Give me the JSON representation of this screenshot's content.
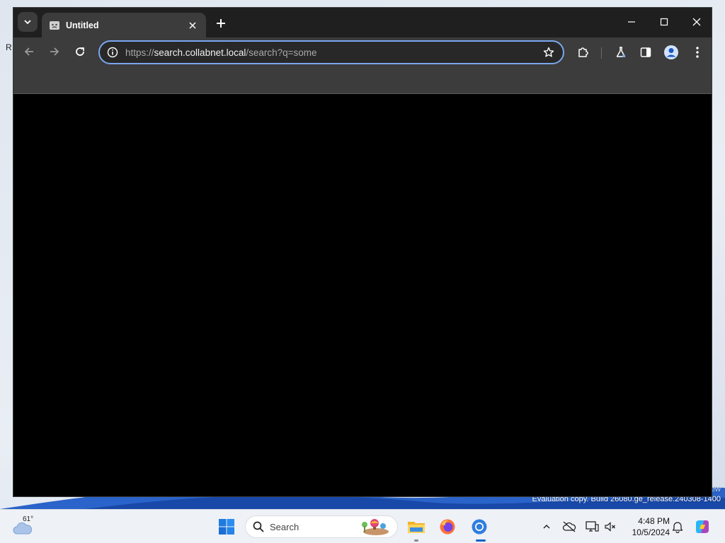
{
  "desktop": {
    "fragment_text": "R",
    "watermark_line1": "ew",
    "watermark_line2": "Evaluation copy. Build 26080.ge_release.240308-1400"
  },
  "browser": {
    "tab": {
      "title": "Untitled"
    },
    "address_bar": {
      "scheme": "https://",
      "host": "search.collabnet.local",
      "path": "/search?q=some"
    }
  },
  "taskbar": {
    "weather": {
      "temp": "61°"
    },
    "search": {
      "label": "Search"
    },
    "clock": {
      "time": "4:48 PM",
      "date": "10/5/2024"
    }
  },
  "colors": {
    "accent": "#7aa7ee",
    "taskbar_active": "#0a64c8"
  }
}
